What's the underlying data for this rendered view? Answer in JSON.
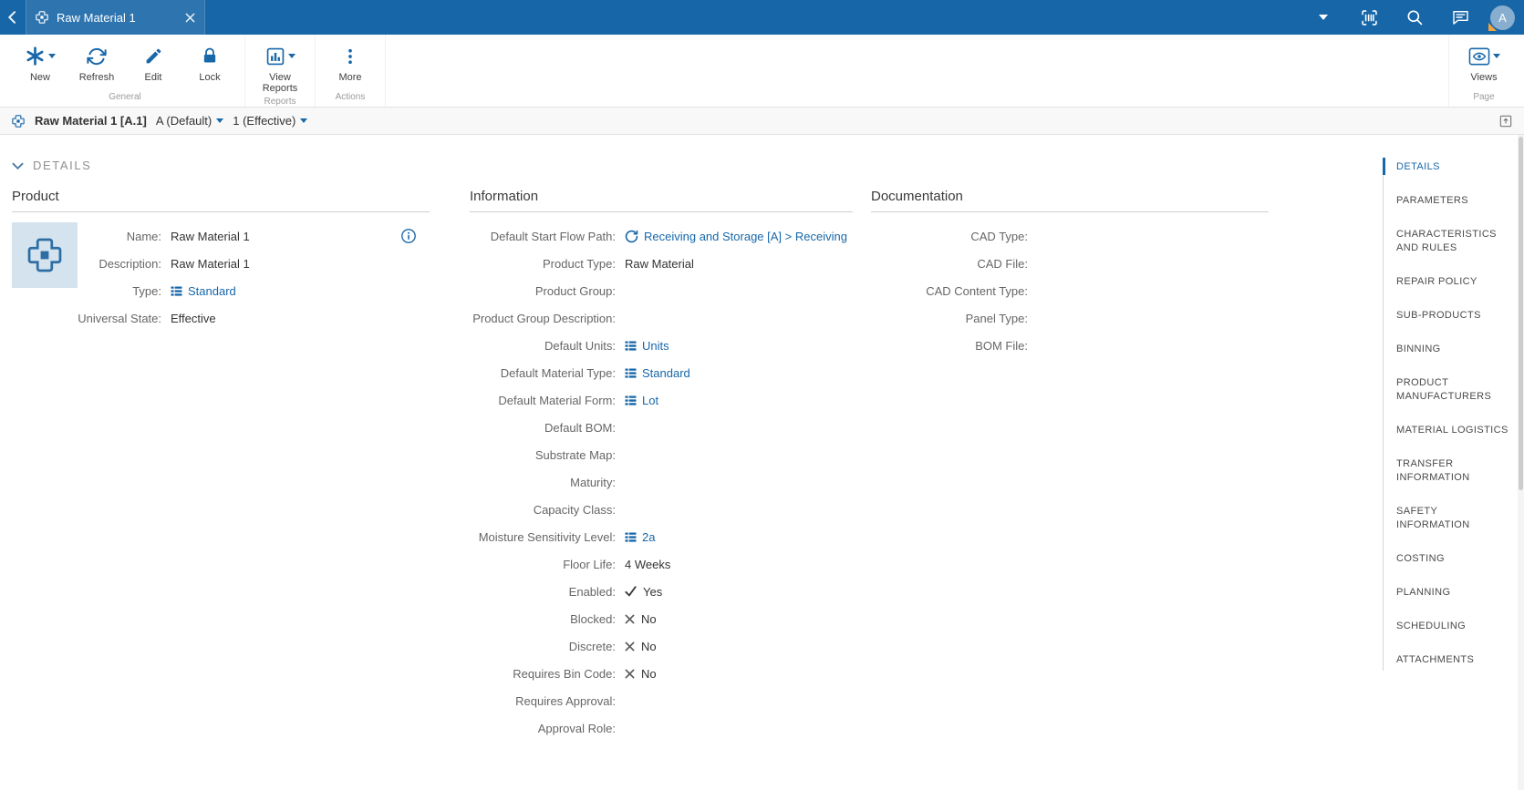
{
  "topbar": {
    "tab_title": "Raw Material 1",
    "avatar_initial": "A"
  },
  "ribbon": {
    "groups": [
      {
        "label": "General",
        "buttons": [
          {
            "label": "New",
            "icon": "asterisk-icon",
            "dropdown": true
          },
          {
            "label": "Refresh",
            "icon": "refresh-icon",
            "dropdown": false
          },
          {
            "label": "Edit",
            "icon": "edit-icon",
            "dropdown": false
          },
          {
            "label": "Lock",
            "icon": "lock-icon",
            "dropdown": false
          }
        ]
      },
      {
        "label": "Reports",
        "buttons": [
          {
            "label": "View Reports",
            "icon": "reports-icon",
            "dropdown": true
          }
        ]
      },
      {
        "label": "Actions",
        "buttons": [
          {
            "label": "More",
            "icon": "more-icon",
            "dropdown": false
          }
        ]
      },
      {
        "label": "Page",
        "align": "right",
        "buttons": [
          {
            "label": "Views",
            "icon": "views-icon",
            "dropdown": true
          }
        ]
      }
    ]
  },
  "breadcrumb": {
    "title": "Raw Material 1 [A.1]",
    "version": "A (Default)",
    "revision": "1 (Effective)"
  },
  "page": {
    "section_title": "DETAILS",
    "columns": [
      {
        "header": "Product",
        "has_image": true,
        "fields": [
          {
            "label": "Name:",
            "value": "Raw Material 1",
            "type": "text",
            "info": true
          },
          {
            "label": "Description:",
            "value": "Raw Material 1",
            "type": "text"
          },
          {
            "label": "Type:",
            "value": "Standard",
            "type": "entity-link"
          },
          {
            "label": "Universal State:",
            "value": "Effective",
            "type": "text"
          }
        ]
      },
      {
        "header": "Information",
        "fields": [
          {
            "label": "Default Start Flow Path:",
            "value": "Receiving and Storage [A] > Receiving",
            "type": "flow-link"
          },
          {
            "label": "Product Type:",
            "value": "Raw Material",
            "type": "text"
          },
          {
            "label": "Product Group:",
            "value": "",
            "type": "text"
          },
          {
            "label": "Product Group Description:",
            "value": "",
            "type": "text"
          },
          {
            "label": "Default Units:",
            "value": "Units",
            "type": "entity-link"
          },
          {
            "label": "Default Material Type:",
            "value": "Standard",
            "type": "entity-link"
          },
          {
            "label": "Default Material Form:",
            "value": "Lot",
            "type": "entity-link"
          },
          {
            "label": "Default BOM:",
            "value": "",
            "type": "text"
          },
          {
            "label": "Substrate Map:",
            "value": "",
            "type": "text"
          },
          {
            "label": "Maturity:",
            "value": "",
            "type": "text"
          },
          {
            "label": "Capacity Class:",
            "value": "",
            "type": "text"
          },
          {
            "label": "Moisture Sensitivity Level:",
            "value": "2a",
            "type": "entity-link"
          },
          {
            "label": "Floor Life:",
            "value": "4 Weeks",
            "type": "text"
          },
          {
            "label": "Enabled:",
            "value": "Yes",
            "type": "bool-yes"
          },
          {
            "label": "Blocked:",
            "value": "No",
            "type": "bool-no"
          },
          {
            "label": "Discrete:",
            "value": "No",
            "type": "bool-no"
          },
          {
            "label": "Requires Bin Code:",
            "value": "No",
            "type": "bool-no"
          },
          {
            "label": "Requires Approval:",
            "value": "",
            "type": "text"
          },
          {
            "label": "Approval Role:",
            "value": "",
            "type": "text"
          }
        ]
      },
      {
        "header": "Documentation",
        "fields": [
          {
            "label": "CAD Type:",
            "value": "",
            "type": "text"
          },
          {
            "label": "CAD File:",
            "value": "",
            "type": "text"
          },
          {
            "label": "CAD Content Type:",
            "value": "",
            "type": "text"
          },
          {
            "label": "Panel Type:",
            "value": "",
            "type": "text"
          },
          {
            "label": "BOM File:",
            "value": "",
            "type": "text"
          }
        ]
      }
    ]
  },
  "sidenav": {
    "items": [
      {
        "label": "DETAILS",
        "active": true
      },
      {
        "label": "PARAMETERS",
        "active": false
      },
      {
        "label": "CHARACTERISTICS AND RULES",
        "active": false
      },
      {
        "label": "REPAIR POLICY",
        "active": false
      },
      {
        "label": "SUB-PRODUCTS",
        "active": false
      },
      {
        "label": "BINNING",
        "active": false
      },
      {
        "label": "PRODUCT MANUFACTURERS",
        "active": false
      },
      {
        "label": "MATERIAL LOGISTICS",
        "active": false
      },
      {
        "label": "TRANSFER INFORMATION",
        "active": false
      },
      {
        "label": "SAFETY INFORMATION",
        "active": false
      },
      {
        "label": "COSTING",
        "active": false
      },
      {
        "label": "PLANNING",
        "active": false
      },
      {
        "label": "SCHEDULING",
        "active": false
      },
      {
        "label": "ATTACHMENTS",
        "active": false
      }
    ]
  },
  "colors": {
    "primary": "#1767A9",
    "topbar": "#1766A8",
    "link": "#1767A9",
    "avatar_bg": "#87AECE",
    "warning_badge": "#F2A33A",
    "product_image_bg": "#D5E3EF"
  }
}
